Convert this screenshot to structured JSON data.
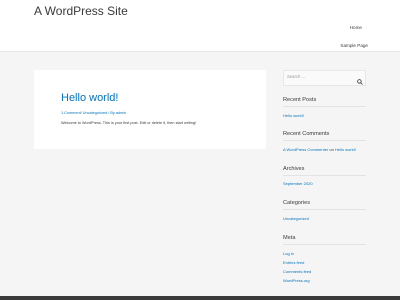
{
  "site": {
    "title": "A WordPress Site"
  },
  "nav": {
    "home": "Home",
    "sample_page": "Sample Page"
  },
  "post": {
    "title": "Hello world!",
    "comments_link": "1 Comment",
    "category": "Uncategorized",
    "author": "admin",
    "meta_sep_1": "/ ",
    "meta_sep_2": " / By ",
    "excerpt": "Welcome to WordPress. This is your first post. Edit or delete it, then start writing!"
  },
  "sidebar": {
    "search": {
      "placeholder": "Search …",
      "icon": "search-icon"
    },
    "recent_posts": {
      "title": "Recent Posts",
      "items": [
        "Hello world!"
      ]
    },
    "recent_comments": {
      "title": "Recent Comments",
      "commenter": "A WordPress Commenter",
      "on_text": " on ",
      "post": "Hello world!"
    },
    "archives": {
      "title": "Archives",
      "items": [
        "September 2020"
      ]
    },
    "categories": {
      "title": "Categories",
      "items": [
        "Uncategorized"
      ]
    },
    "meta": {
      "title": "Meta",
      "items": [
        "Log in",
        "Entries feed",
        "Comments feed",
        "WordPress.org"
      ]
    }
  },
  "colors": {
    "link": "#0274be",
    "text": "#3a3a3a",
    "page_bg": "#f5f5f5",
    "footer": "#3a3a3a"
  }
}
